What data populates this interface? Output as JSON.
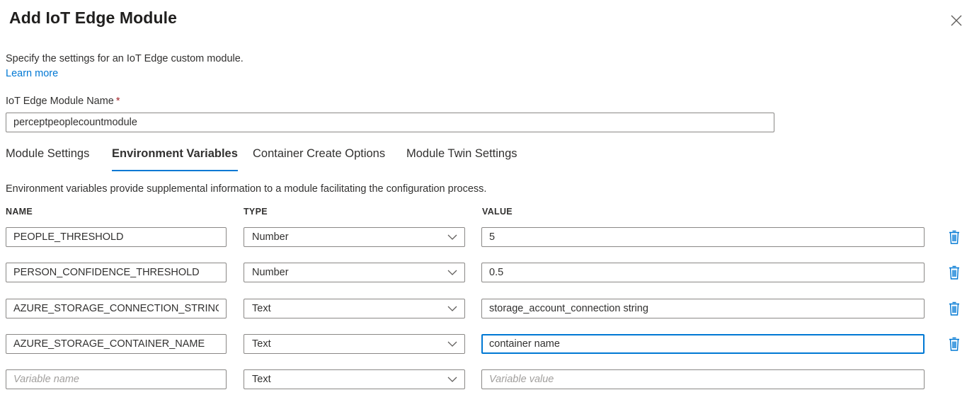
{
  "window": {
    "title": "Add IoT Edge Module",
    "close_icon": "close-icon"
  },
  "intro": {
    "description": "Specify the settings for an IoT Edge custom module.",
    "learn_more": "Learn more"
  },
  "module_name": {
    "label": "IoT Edge Module Name",
    "required_mark": "*",
    "value": "perceptpeoplecountmodule"
  },
  "tabs": [
    {
      "label": "Module Settings",
      "active": false
    },
    {
      "label": "Environment Variables",
      "active": true
    },
    {
      "label": "Container Create Options",
      "active": false
    },
    {
      "label": "Module Twin Settings",
      "active": false
    }
  ],
  "env": {
    "description": "Environment variables provide supplemental information to a module facilitating the configuration process.",
    "columns": {
      "name": "NAME",
      "type": "TYPE",
      "value": "VALUE"
    },
    "rows": [
      {
        "name": "PEOPLE_THRESHOLD",
        "type": "Number",
        "value": "5"
      },
      {
        "name": "PERSON_CONFIDENCE_THRESHOLD",
        "type": "Number",
        "value": "0.5"
      },
      {
        "name": "AZURE_STORAGE_CONNECTION_STRING",
        "type": "Text",
        "value": "storage_account_connection string"
      },
      {
        "name": "AZURE_STORAGE_CONTAINER_NAME",
        "type": "Text",
        "value": "container name"
      }
    ],
    "new_row": {
      "name_placeholder": "Variable name",
      "type": "Text",
      "value_placeholder": "Variable value"
    }
  },
  "colors": {
    "accent": "#0078d4",
    "delete_icon": "#0078d4",
    "required": "#a4262c"
  }
}
